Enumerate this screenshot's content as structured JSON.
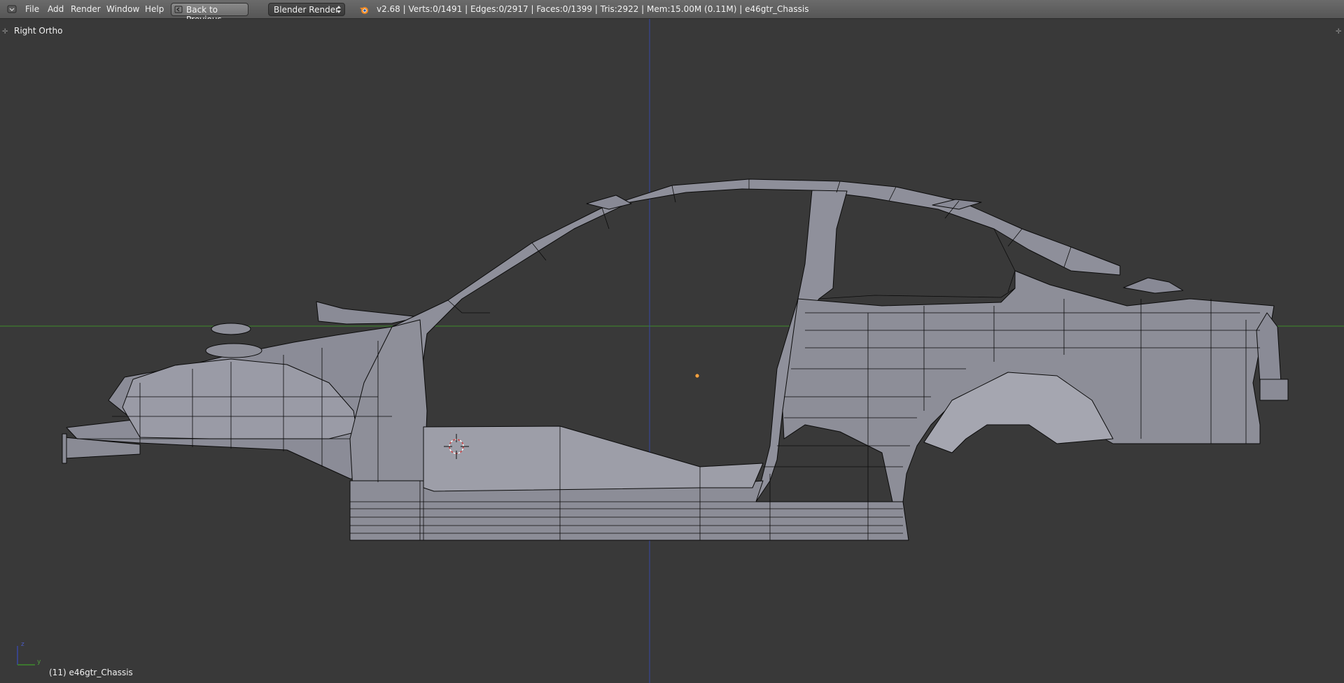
{
  "header": {
    "menus": [
      "File",
      "Add",
      "Render",
      "Window",
      "Help"
    ],
    "back_button": "Back to Previous",
    "render_engine": "Blender Render",
    "stats": "v2.68 | Verts:0/1491 | Edges:0/2917 | Faces:0/1399 | Tris:2922 | Mem:15.00M (0.11M) | e46gtr_Chassis"
  },
  "viewport": {
    "view_name": "Right Ortho",
    "object_info": "(11) e46gtr_Chassis",
    "axis_labels": {
      "up": "z",
      "right": "y"
    }
  },
  "colors": {
    "background": "#393939",
    "mesh_face": "#8d8e99",
    "mesh_wire": "#000000",
    "y_axis_line": "#3e8a2c",
    "z_axis_line": "#3848a3",
    "origin": "#f0a040",
    "cursor": "#d04040"
  },
  "icons": {
    "corner": "editor-type-icon",
    "back": "screen-back-icon",
    "logo": "blender-logo-icon",
    "cursor": "3d-cursor-icon"
  }
}
